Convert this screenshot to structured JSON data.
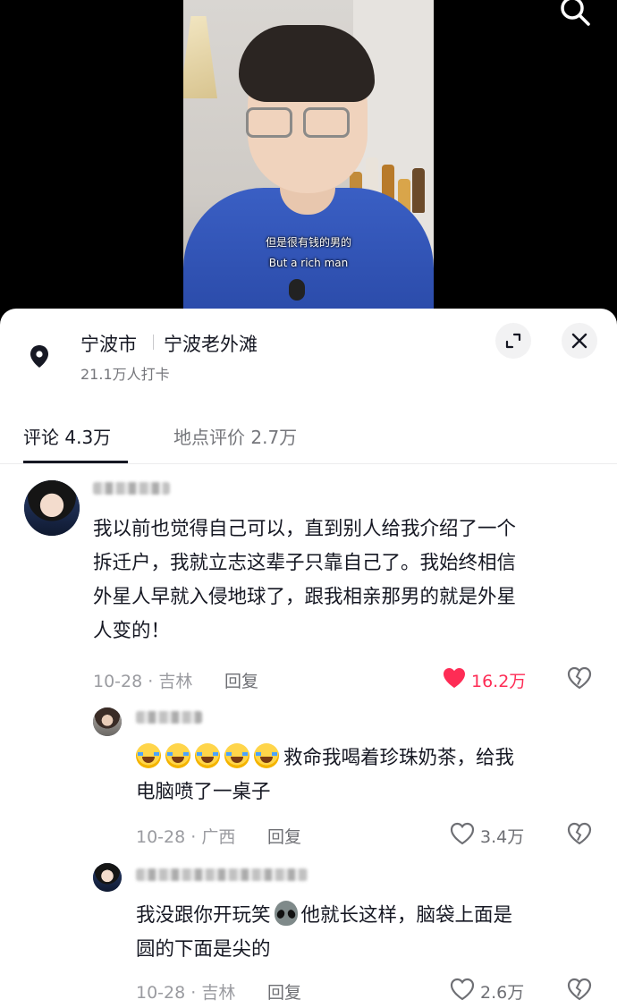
{
  "video": {
    "subtitle_cn": "但是很有钱的男的",
    "subtitle_en": "But a rich man"
  },
  "location": {
    "city": "宁波市",
    "place": "宁波老外滩",
    "checkins": "21.1万人打卡"
  },
  "tabs": [
    {
      "label": "评论 4.3万",
      "active": true
    },
    {
      "label": "地点评价 2.7万",
      "active": false
    }
  ],
  "comments": [
    {
      "text_lines": [
        "我以前也觉得自己可以，直到别人给我介绍了一个",
        "拆迁户，我就立志这辈子只靠自己了。我始终相信",
        "外星人早就入侵地球了，跟我相亲那男的就是外星",
        "人变的！"
      ],
      "meta": "10-28 · 吉林",
      "reply_label": "回复",
      "likes": "16.2万",
      "liked": true
    },
    {
      "text_line1": "救命我喝着珍珠奶茶，给我",
      "text_line2": "电脑喷了一桌子",
      "meta": "10-28 · 广西",
      "reply_label": "回复",
      "likes": "3.4万",
      "liked": false
    },
    {
      "text_line1_a": "我没跟你开玩笑",
      "text_line1_b": "他就长这样，脑袋上面是",
      "text_line2": "圆的下面是尖的",
      "meta": "10-28 · 吉林",
      "reply_label": "回复",
      "likes": "2.6万",
      "liked": false
    }
  ],
  "colors": {
    "like_active": "#fe2c55",
    "text_primary": "#161823",
    "text_secondary": "#9a9ba0"
  },
  "icons": [
    "search-icon",
    "location-pin-icon",
    "expand-icon",
    "close-icon",
    "heart-icon",
    "broken-heart-icon"
  ]
}
